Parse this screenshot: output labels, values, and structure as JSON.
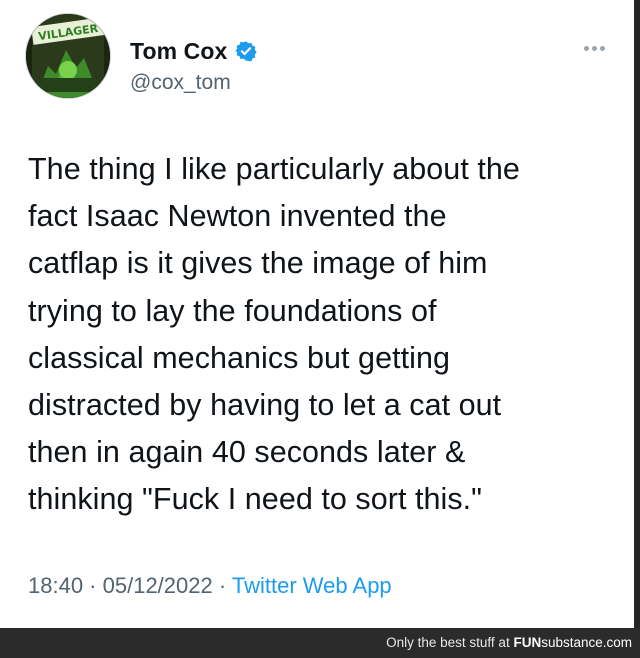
{
  "author": {
    "name": "Tom Cox",
    "handle": "@cox_tom",
    "avatar_text": "VILLAGER"
  },
  "tweet": {
    "text": "The thing I like particularly about the\nfact Isaac Newton invented the\ncatflap is it gives the image of him\ntrying to lay the foundations of\nclassical mechanics but getting\ndistracted by having to let a cat out\nthen in again 40 seconds later &\nthinking \"Fuck I need to sort this.\"",
    "time": "18:40",
    "date": "05/12/2022",
    "separator": " · ",
    "source": "Twitter Web App"
  },
  "footer": {
    "tagline": "Only the best stuff at ",
    "brand_bold": "FUN",
    "brand_rest": "substance.com"
  },
  "colors": {
    "text": "#0f1419",
    "secondary": "#536471",
    "link": "#1d9bf0",
    "verified": "#1d9bf0",
    "footer_bg": "#2b2b2b"
  },
  "icons": {
    "verified": "verified-badge-icon",
    "more": "more-options-icon"
  }
}
